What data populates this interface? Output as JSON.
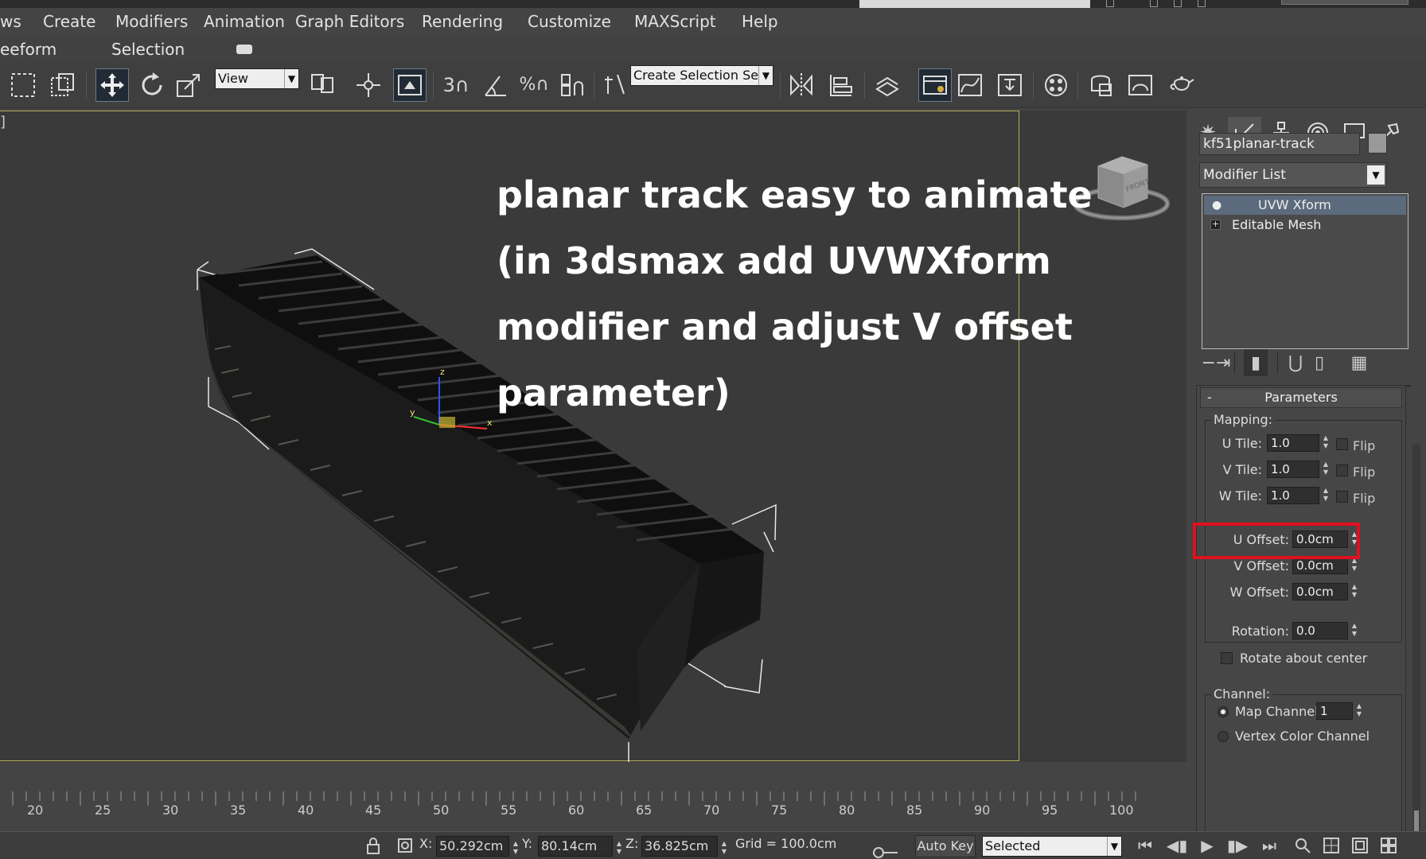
{
  "menu": {
    "items": [
      "ws",
      "Create",
      "Modifiers",
      "Animation",
      "Graph Editors",
      "Rendering",
      "Customize",
      "MAXScript",
      "Help"
    ]
  },
  "ribbon": {
    "tabs": [
      "eeform",
      "Selection"
    ]
  },
  "toolbar": {
    "reference_coord": "View",
    "selection_set": "Create Selection Se"
  },
  "viewport": {
    "label": "]",
    "annotation": [
      "planar track easy to animate",
      "(in 3dsmax add UVWXform",
      "modifier and adjust V offset",
      "parameter)"
    ],
    "gizmo_axes": [
      "z",
      "y",
      "x"
    ],
    "viewcube_face": "FRONT"
  },
  "command_panel": {
    "object_name": "kf51planar-track",
    "modifier_list": "Modifier List",
    "stack": [
      "UVW Xform",
      "Editable Mesh"
    ],
    "rollout_title": "Parameters",
    "mapping_label": "Mapping:",
    "tiles": [
      {
        "label": "U Tile:",
        "value": "1.0",
        "flip": "Flip"
      },
      {
        "label": "V Tile:",
        "value": "1.0",
        "flip": "Flip"
      },
      {
        "label": "W Tile:",
        "value": "1.0",
        "flip": "Flip"
      }
    ],
    "offsets": [
      {
        "label": "U Offset:",
        "value": "0.0cm"
      },
      {
        "label": "V Offset:",
        "value": "0.0cm"
      },
      {
        "label": "W Offset:",
        "value": "0.0cm"
      }
    ],
    "rotation_label": "Rotation:",
    "rotation_value": "0.0",
    "rotate_center": "Rotate about center",
    "channel_label": "Channel:",
    "map_channel_label": "Map Channel:",
    "map_channel_value": "1",
    "vertex_color": "Vertex Color Channel",
    "highlight_color": "#e01020"
  },
  "timeline": {
    "labels": [
      "20",
      "25",
      "30",
      "35",
      "40",
      "45",
      "50",
      "55",
      "60",
      "65",
      "70",
      "75",
      "80",
      "85",
      "90",
      "95",
      "100"
    ]
  },
  "status": {
    "x_label": "X:",
    "x_value": "50.292cm",
    "y_label": "Y:",
    "y_value": "80.14cm",
    "z_label": "Z:",
    "z_value": "36.825cm",
    "grid": "Grid = 100.0cm",
    "autokey": "Auto Key",
    "selected": "Selected"
  }
}
